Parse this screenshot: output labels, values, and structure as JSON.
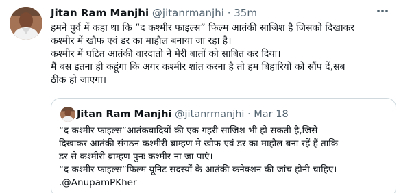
{
  "tweet": {
    "author_name": "Jitan Ram Manjhi",
    "handle": "@jitanrmanjhi",
    "separator": "·",
    "time": "35m",
    "more_icon": "more-horizontal-icon",
    "text_lines": [
      "हमने पुर्व में कहा था कि “द कश्मीर फाइल्स” फिल्म आतंकी साजिश है जिसको दिखाकर",
      "कश्मीर में खौफ एवं डर का माहौल बनाया जा रहा है।",
      "कश्मीर में घटित आतंकी वारदातो ने मेरी बातों को साबित कर दिया।",
      "मैं बस इतना ही कहूंगा कि अगर कश्मीर शांत करना है तो हम बिहारियों को सौंप दें,सब",
      "ठीक हो जाएगा।"
    ]
  },
  "quoted": {
    "author_name": "Jitan Ram Manjhi",
    "handle": "@jitanrmanjhi",
    "separator": "·",
    "time": "Mar 18",
    "text_lines": [
      "“द कश्मीर फाइल्स”आतंकवादियों की एक गहरी साजिश भी हो सकती है,जिसे",
      "दिखाकर आतंकी संगठन कश्मीरी ब्राम्हण मे खौफ एवं डर का माहौल बना रहें हैं ताकि",
      "डर से कश्मीरी ब्राम्हण पुनः कश्मीर ना जा पाएं।",
      "“द कश्मीर फाइल्स”फिल्म यूनिट सदस्यों के आतंकी कनेक्शन की जांच होनी चाहिए।",
      ".@AnupamPKher"
    ]
  },
  "colors": {
    "text": "#0f1419",
    "secondary": "#536471",
    "border": "#cfd9de"
  }
}
